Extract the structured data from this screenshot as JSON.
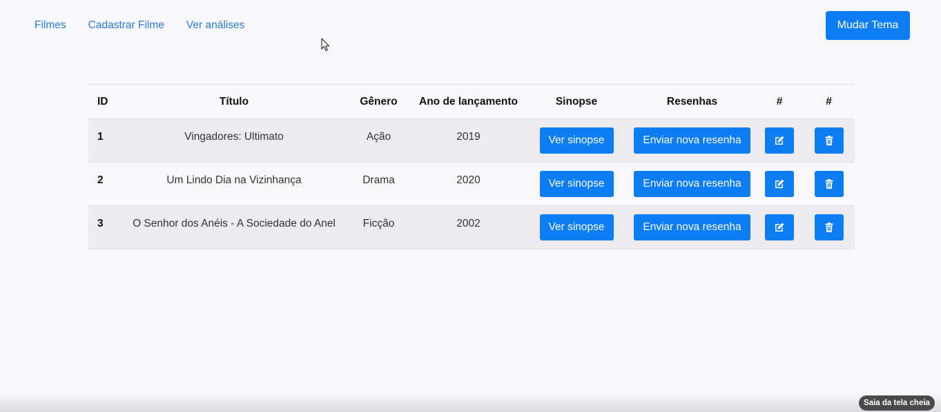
{
  "nav": {
    "links": [
      "Filmes",
      "Cadastrar Filme",
      "Ver análises"
    ],
    "theme_button": "Mudar Tema"
  },
  "table": {
    "headers": [
      "ID",
      "Título",
      "Gênero",
      "Ano de lançamento",
      "Sinopse",
      "Resenhas",
      "#",
      "#"
    ],
    "rows": [
      {
        "id": "1",
        "title": "Vingadores: Ultimato",
        "genre": "Ação",
        "year": "2019",
        "synopsis_button": "Ver sinopse",
        "review_button": "Enviar nova resenha",
        "edit_icon": "edit-icon",
        "delete_icon": "trash-icon"
      },
      {
        "id": "2",
        "title": "Um Lindo Dia na Vizinhança",
        "genre": "Drama",
        "year": "2020",
        "synopsis_button": "Ver sinopse",
        "review_button": "Enviar nova resenha",
        "edit_icon": "edit-icon",
        "delete_icon": "trash-icon"
      },
      {
        "id": "3",
        "title": "O Senhor dos Anéis - A Sociedade do Anel",
        "genre": "Ficção",
        "year": "2002",
        "synopsis_button": "Ver sinopse",
        "review_button": "Enviar nova resenha",
        "edit_icon": "edit-icon",
        "delete_icon": "trash-icon"
      }
    ]
  },
  "fullscreen_badge": "Saia da tela cheia",
  "colors": {
    "accent": "#0d7df3",
    "link": "#2a7ad9",
    "background": "#f8f8fb",
    "stripe": "#ececf0"
  }
}
